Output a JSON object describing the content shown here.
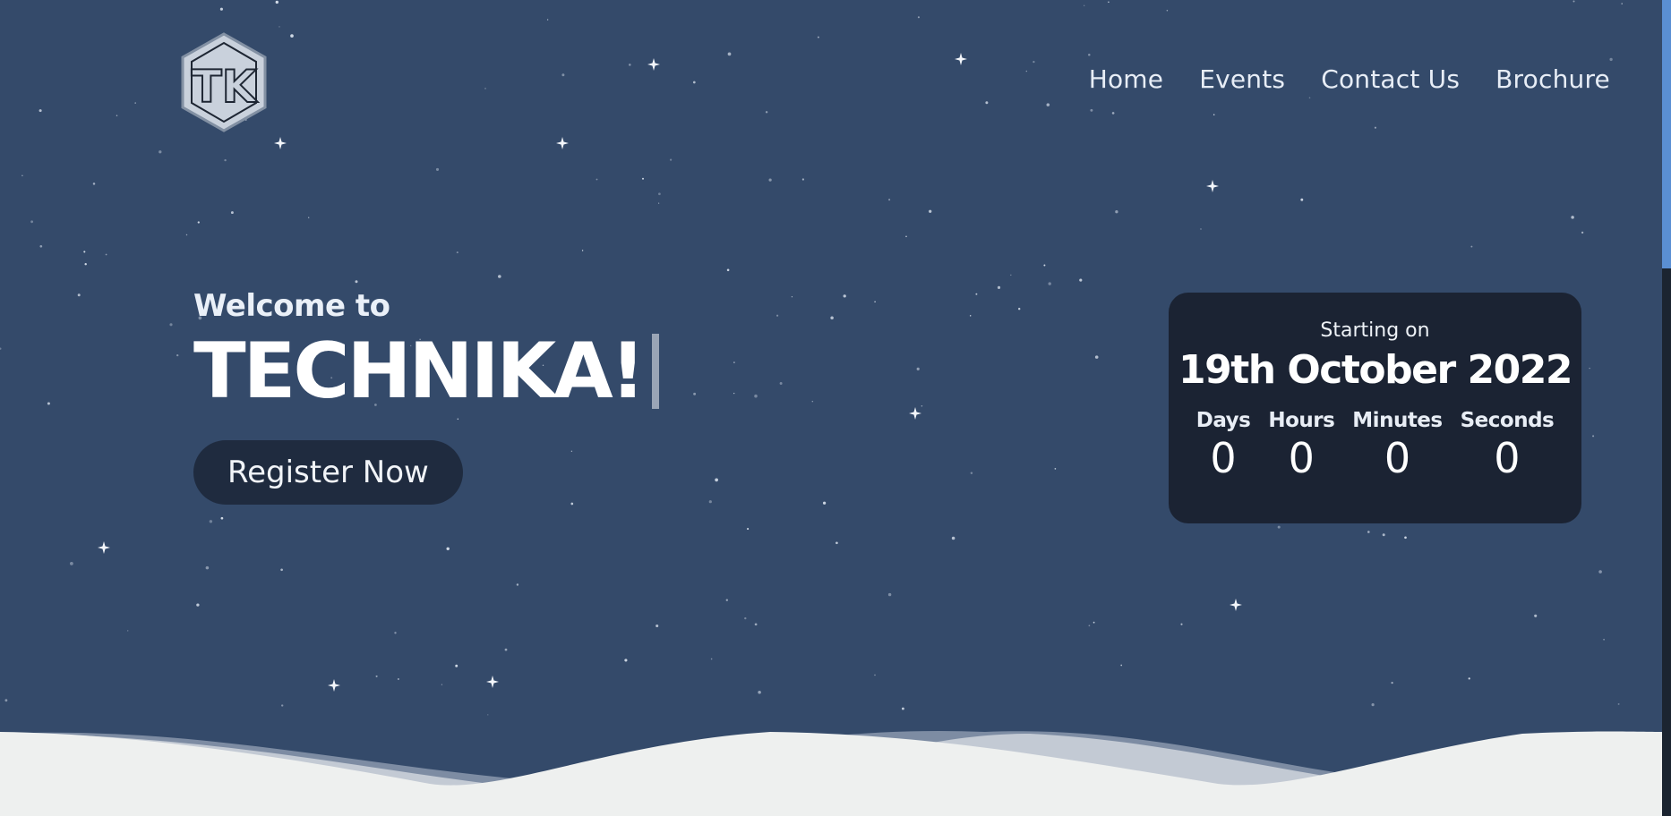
{
  "logo": {
    "letters": "TK"
  },
  "nav": [
    "Home",
    "Events",
    "Contact Us",
    "Brochure"
  ],
  "hero": {
    "welcome": "Welcome to",
    "title": "TECHNIKA!",
    "button": "Register Now"
  },
  "countdown": {
    "starting_label": "Starting on",
    "date": "19th October 2022",
    "units": [
      {
        "label": "Days",
        "value": "0"
      },
      {
        "label": "Hours",
        "value": "0"
      },
      {
        "label": "Minutes",
        "value": "0"
      },
      {
        "label": "Seconds",
        "value": "0"
      }
    ]
  },
  "colors": {
    "sky": "#344a6a",
    "panel": "#1b2333",
    "snow": "#eef0ef",
    "accent": "#5a8fd3"
  }
}
